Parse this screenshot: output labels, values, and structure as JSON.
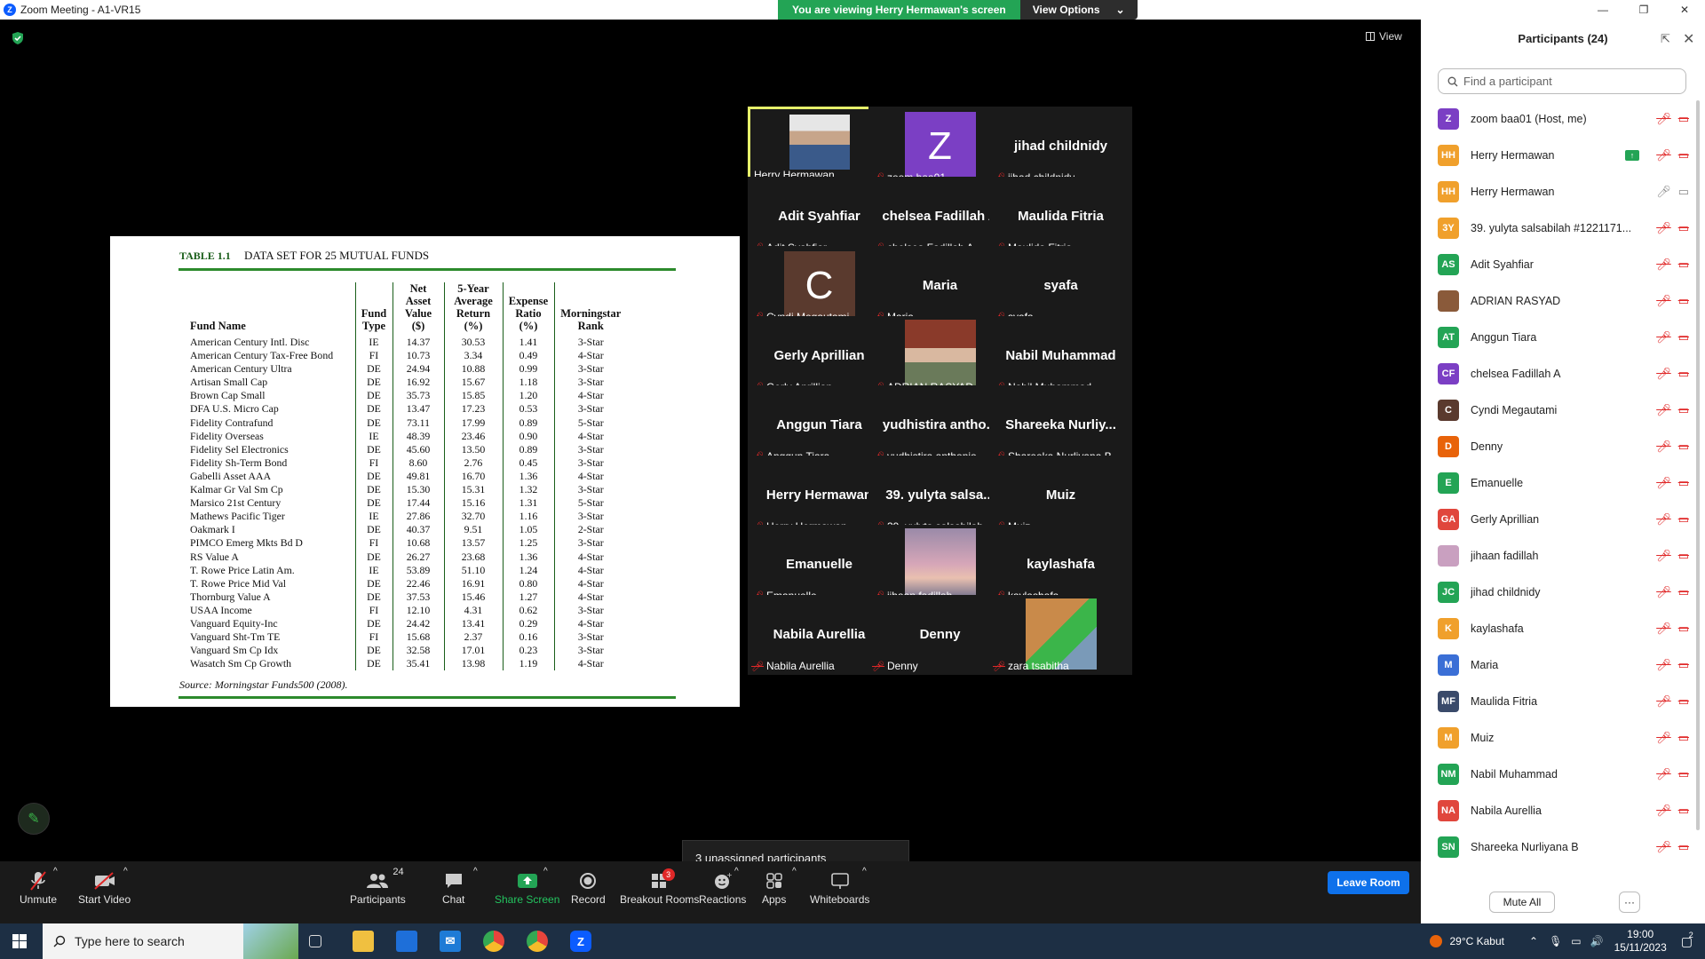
{
  "window": {
    "title": "Zoom Meeting - A1-VR15"
  },
  "banner": {
    "message": "You are viewing Herry Hermawan's screen",
    "options_label": "View Options"
  },
  "view_label": "View",
  "slide": {
    "table_number": "TABLE 1.1",
    "table_title": "DATA SET FOR 25 MUTUAL FUNDS",
    "headers": [
      "Fund Name",
      "Fund Type",
      "Net Asset Value ($)",
      "5-Year Average Return (%)",
      "Expense Ratio (%)",
      "Morningstar Rank"
    ],
    "rows": [
      [
        "American Century Intl. Disc",
        "IE",
        "14.37",
        "30.53",
        "1.41",
        "3-Star"
      ],
      [
        "American Century Tax-Free Bond",
        "FI",
        "10.73",
        "3.34",
        "0.49",
        "4-Star"
      ],
      [
        "American Century Ultra",
        "DE",
        "24.94",
        "10.88",
        "0.99",
        "3-Star"
      ],
      [
        "Artisan Small Cap",
        "DE",
        "16.92",
        "15.67",
        "1.18",
        "3-Star"
      ],
      [
        "Brown Cap Small",
        "DE",
        "35.73",
        "15.85",
        "1.20",
        "4-Star"
      ],
      [
        "DFA U.S. Micro Cap",
        "DE",
        "13.47",
        "17.23",
        "0.53",
        "3-Star"
      ],
      [
        "Fidelity Contrafund",
        "DE",
        "73.11",
        "17.99",
        "0.89",
        "5-Star"
      ],
      [
        "Fidelity Overseas",
        "IE",
        "48.39",
        "23.46",
        "0.90",
        "4-Star"
      ],
      [
        "Fidelity Sel Electronics",
        "DE",
        "45.60",
        "13.50",
        "0.89",
        "3-Star"
      ],
      [
        "Fidelity Sh-Term Bond",
        "FI",
        "8.60",
        "2.76",
        "0.45",
        "3-Star"
      ],
      [
        "Gabelli Asset AAA",
        "DE",
        "49.81",
        "16.70",
        "1.36",
        "4-Star"
      ],
      [
        "Kalmar Gr Val Sm Cp",
        "DE",
        "15.30",
        "15.31",
        "1.32",
        "3-Star"
      ],
      [
        "Marsico 21st Century",
        "DE",
        "17.44",
        "15.16",
        "1.31",
        "5-Star"
      ],
      [
        "Mathews Pacific Tiger",
        "IE",
        "27.86",
        "32.70",
        "1.16",
        "3-Star"
      ],
      [
        "Oakmark I",
        "DE",
        "40.37",
        "9.51",
        "1.05",
        "2-Star"
      ],
      [
        "PIMCO Emerg Mkts Bd D",
        "FI",
        "10.68",
        "13.57",
        "1.25",
        "3-Star"
      ],
      [
        "RS Value A",
        "DE",
        "26.27",
        "23.68",
        "1.36",
        "4-Star"
      ],
      [
        "T. Rowe Price Latin Am.",
        "IE",
        "53.89",
        "51.10",
        "1.24",
        "4-Star"
      ],
      [
        "T. Rowe Price Mid Val",
        "DE",
        "22.46",
        "16.91",
        "0.80",
        "4-Star"
      ],
      [
        "Thornburg Value A",
        "DE",
        "37.53",
        "15.46",
        "1.27",
        "4-Star"
      ],
      [
        "USAA Income",
        "FI",
        "12.10",
        "4.31",
        "0.62",
        "3-Star"
      ],
      [
        "Vanguard Equity-Inc",
        "DE",
        "24.42",
        "13.41",
        "0.29",
        "4-Star"
      ],
      [
        "Vanguard Sht-Tm TE",
        "FI",
        "15.68",
        "2.37",
        "0.16",
        "3-Star"
      ],
      [
        "Vanguard Sm Cp Idx",
        "DE",
        "32.58",
        "17.01",
        "0.23",
        "3-Star"
      ],
      [
        "Wasatch Sm Cp Growth",
        "DE",
        "35.41",
        "13.98",
        "1.19",
        "4-Star"
      ]
    ],
    "source": "Source: Morningstar Funds500 (2008)."
  },
  "gallery": [
    {
      "center": "",
      "label": "Herry Hermawan",
      "kind": "photo",
      "muted": false,
      "active": true
    },
    {
      "center": "Z",
      "label": "zoom baa01",
      "kind": "letter",
      "color": "#7b3fc4",
      "muted": true
    },
    {
      "center": "jihad childnidy",
      "label": "jihad childnidy",
      "kind": "name",
      "muted": true
    },
    {
      "center": "Adit Syahfiar",
      "label": "Adit Syahfiar",
      "kind": "name",
      "muted": true
    },
    {
      "center": "chelsea Fadillah A",
      "label": "chelsea Fadillah A",
      "kind": "name",
      "muted": true
    },
    {
      "center": "Maulida Fitria",
      "label": "Maulida Fitria",
      "kind": "name",
      "muted": true
    },
    {
      "center": "C",
      "label": "Cyndi Megautami",
      "kind": "letter",
      "color": "#5a3a2e",
      "muted": true
    },
    {
      "center": "Maria",
      "label": "Maria",
      "kind": "name",
      "muted": true
    },
    {
      "center": "syafa",
      "label": "syafa",
      "kind": "name",
      "muted": true
    },
    {
      "center": "Gerly Aprillian",
      "label": "Gerly Aprillian",
      "kind": "name",
      "muted": true
    },
    {
      "center": "",
      "label": "ADRIAN RASYAD",
      "kind": "photo2",
      "muted": true
    },
    {
      "center": "Nabil Muhammad",
      "label": "Nabil Muhammad",
      "kind": "name",
      "muted": true
    },
    {
      "center": "Anggun Tiara",
      "label": "Anggun Tiara",
      "kind": "name",
      "muted": true
    },
    {
      "center": "yudhistira antho...",
      "label": "yudhistira anthonio",
      "kind": "name",
      "muted": true
    },
    {
      "center": "Shareeka Nurliy...",
      "label": "Shareeka Nurliyana B",
      "kind": "name",
      "muted": true
    },
    {
      "center": "Herry Hermawan",
      "label": "Herry Hermawan",
      "kind": "name",
      "muted": true
    },
    {
      "center": "39. yulyta salsa...",
      "label": "39. yulyta salsabilah ...",
      "kind": "name",
      "muted": true
    },
    {
      "center": "Muiz",
      "label": "Muiz",
      "kind": "name",
      "muted": true
    },
    {
      "center": "Emanuelle",
      "label": "Emanuelle",
      "kind": "name",
      "muted": true
    },
    {
      "center": "",
      "label": "jihaan fadillah",
      "kind": "sky",
      "muted": true
    },
    {
      "center": "kaylashafa",
      "label": "kaylashafa",
      "kind": "name",
      "muted": true
    },
    {
      "center": "Nabila Aurellia",
      "label": "Nabila Aurellia",
      "kind": "name",
      "muted": true
    },
    {
      "center": "Denny",
      "label": "Denny",
      "kind": "name",
      "muted": true
    },
    {
      "center": "",
      "label": "zara tsabitha",
      "kind": "cat",
      "muted": true
    }
  ],
  "unassigned": "3 unassigned participants",
  "toolbar": {
    "unmute": "Unmute",
    "start_video": "Start Video",
    "participants": "Participants",
    "participant_count": "24",
    "chat": "Chat",
    "share_screen": "Share Screen",
    "record": "Record",
    "breakout_rooms": "Breakout Rooms",
    "breakout_badge": "3",
    "reactions": "Reactions",
    "apps": "Apps",
    "whiteboards": "Whiteboards",
    "leave_room": "Leave Room"
  },
  "panel": {
    "title": "Participants (24)",
    "search_placeholder": "Find a participant",
    "mute_all": "Mute All",
    "more": "···",
    "participants": [
      {
        "initials": "Z",
        "name": "zoom baa01 (Host, me)",
        "color": "#7b3fc4",
        "muted": true
      },
      {
        "initials": "HH",
        "name": "Herry Hermawan",
        "color": "#f0a02c",
        "muted": true,
        "sharing": true
      },
      {
        "initials": "HH",
        "name": "Herry Hermawan",
        "color": "#f0a02c",
        "muted": false
      },
      {
        "initials": "3Y",
        "name": "39. yulyta salsabilah #1221171...",
        "color": "#f0a02c",
        "muted": true
      },
      {
        "initials": "AS",
        "name": "Adit Syahfiar",
        "color": "#23a455",
        "muted": true
      },
      {
        "initials": "",
        "name": "ADRIAN RASYAD",
        "color": "#8a5a3a",
        "muted": true
      },
      {
        "initials": "AT",
        "name": "Anggun Tiara",
        "color": "#23a455",
        "muted": true
      },
      {
        "initials": "CF",
        "name": "chelsea Fadillah A",
        "color": "#7b3fc4",
        "muted": true
      },
      {
        "initials": "C",
        "name": "Cyndi Megautami",
        "color": "#5a3a2e",
        "muted": true
      },
      {
        "initials": "D",
        "name": "Denny",
        "color": "#e8630a",
        "muted": true
      },
      {
        "initials": "E",
        "name": "Emanuelle",
        "color": "#23a455",
        "muted": true
      },
      {
        "initials": "GA",
        "name": "Gerly Aprillian",
        "color": "#e0463c",
        "muted": true
      },
      {
        "initials": "",
        "name": "jihaan fadillah",
        "color": "#c9a0c0",
        "muted": true
      },
      {
        "initials": "JC",
        "name": "jihad childnidy",
        "color": "#23a455",
        "muted": true
      },
      {
        "initials": "K",
        "name": "kaylashafa",
        "color": "#f0a02c",
        "muted": true
      },
      {
        "initials": "M",
        "name": "Maria",
        "color": "#3b6fd6",
        "muted": true
      },
      {
        "initials": "MF",
        "name": "Maulida Fitria",
        "color": "#3a4a6a",
        "muted": true
      },
      {
        "initials": "M",
        "name": "Muiz",
        "color": "#f0a02c",
        "muted": true
      },
      {
        "initials": "NM",
        "name": "Nabil Muhammad",
        "color": "#23a455",
        "muted": true
      },
      {
        "initials": "NA",
        "name": "Nabila Aurellia",
        "color": "#e0463c",
        "muted": true
      },
      {
        "initials": "SN",
        "name": "Shareeka Nurliyana B",
        "color": "#23a455",
        "muted": true
      }
    ]
  },
  "taskbar": {
    "search_placeholder": "Type here to search",
    "weather": "29°C  Kabut",
    "time": "19:00",
    "date": "15/11/2023",
    "notifications": "2"
  }
}
